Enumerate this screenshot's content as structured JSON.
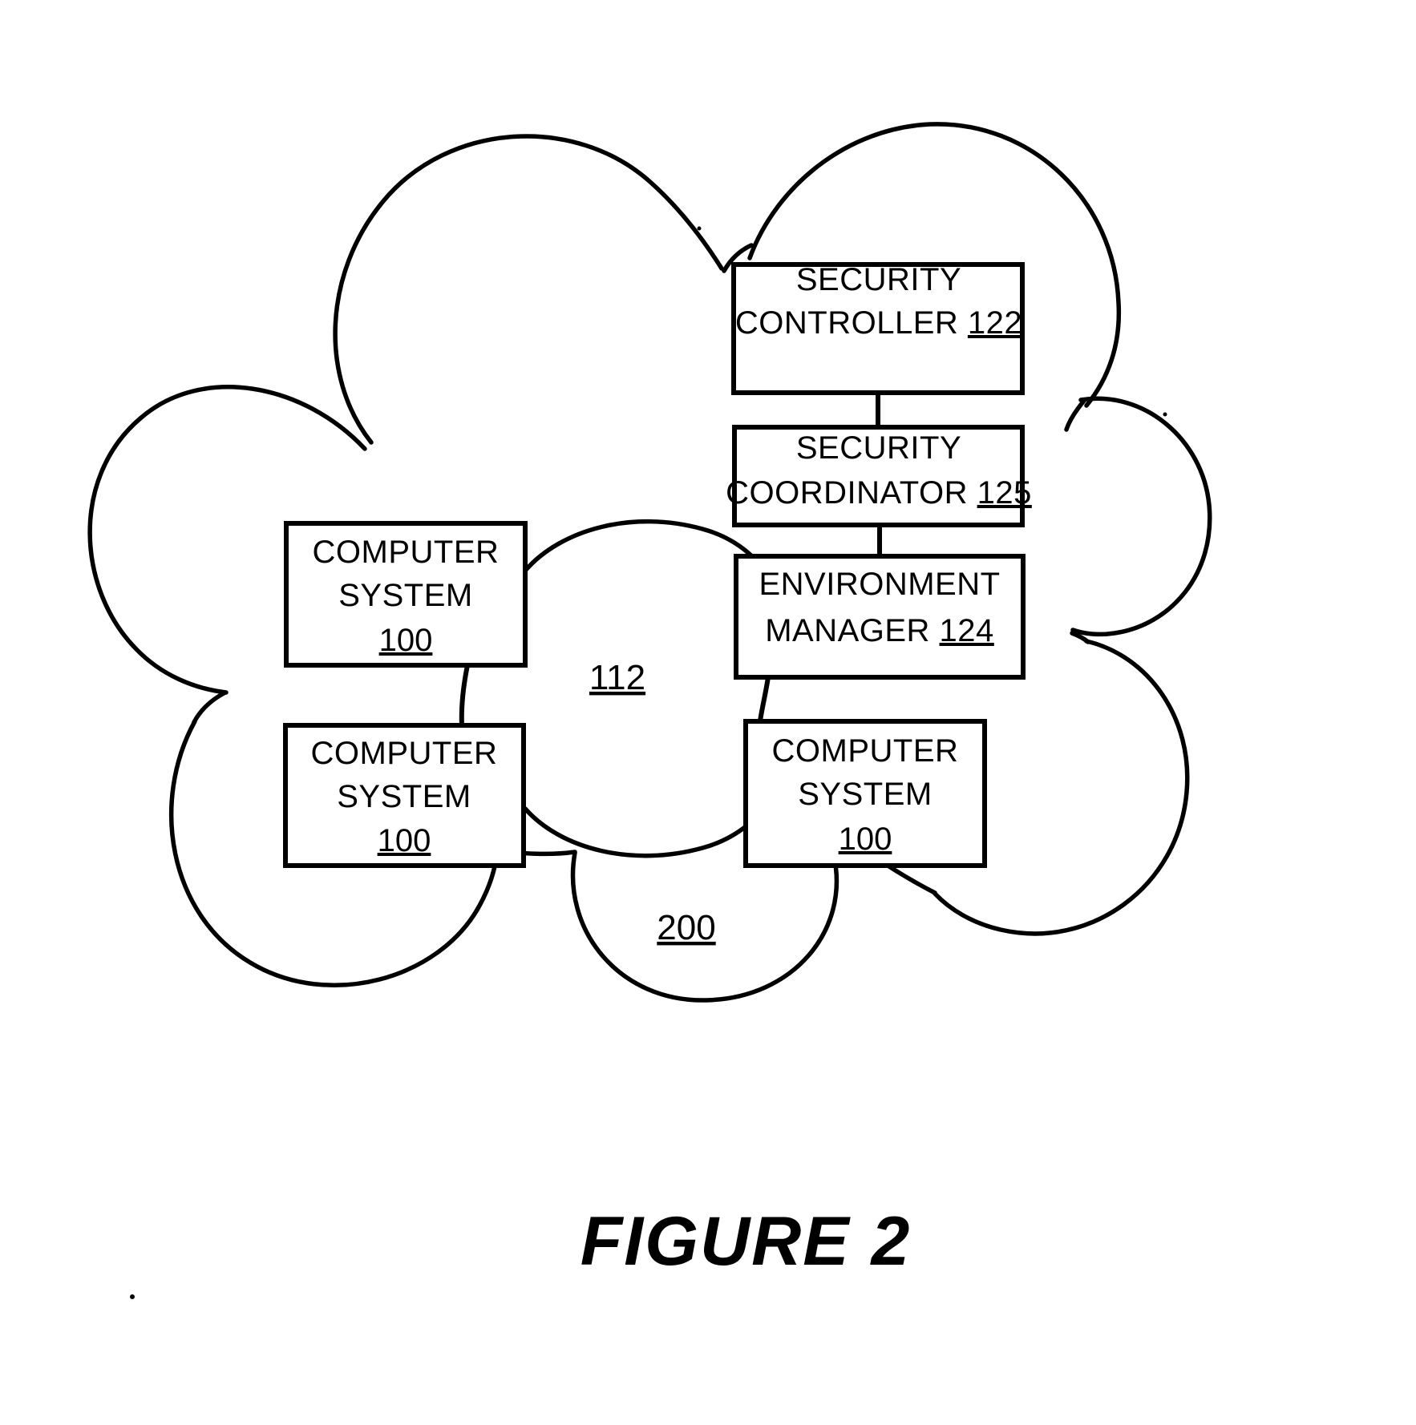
{
  "figure": {
    "caption": "FIGURE 2",
    "outer_cloud_ref": "200",
    "inner_cloud_ref": "112"
  },
  "nodes": {
    "security_controller": {
      "line1": "SECURITY",
      "line2": "CONTROLLER",
      "ref": "122"
    },
    "security_coordinator": {
      "line1": "SECURITY",
      "line2": "COORDINATOR",
      "ref": "125"
    },
    "environment_manager": {
      "line1": "ENVIRONMENT",
      "line2": "MANAGER",
      "ref": "124"
    },
    "computer_system_top_left": {
      "line1": "COMPUTER",
      "line2": "SYSTEM",
      "ref": "100"
    },
    "computer_system_bottom_left": {
      "line1": "COMPUTER",
      "line2": "SYSTEM",
      "ref": "100"
    },
    "computer_system_bottom_right": {
      "line1": "COMPUTER",
      "line2": "SYSTEM",
      "ref": "100"
    }
  },
  "colors": {
    "ink": "#000000",
    "paper": "#ffffff"
  }
}
